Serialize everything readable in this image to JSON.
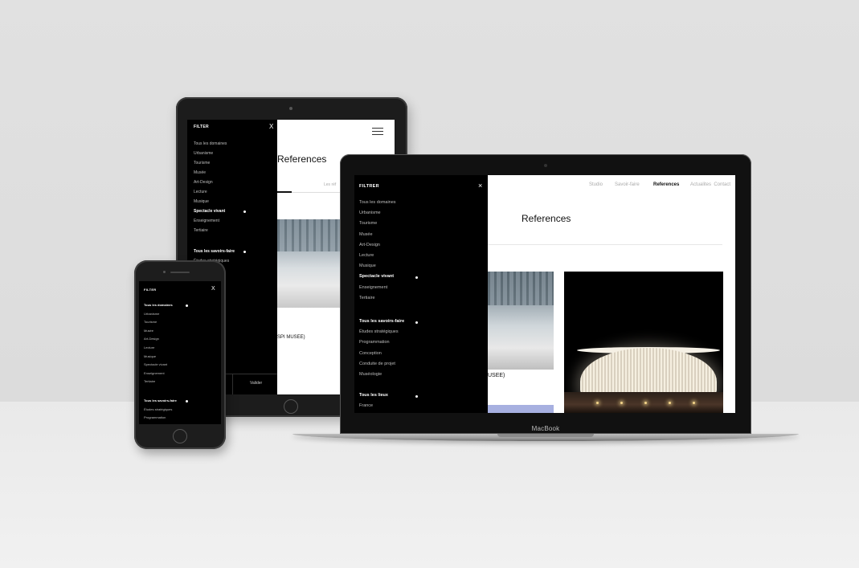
{
  "tablet": {
    "filter": {
      "title": "FILTER",
      "close": "X",
      "domains": [
        {
          "label": "Tous les domaines",
          "active": false
        },
        {
          "label": "Urbanisme",
          "active": false
        },
        {
          "label": "Tourisme",
          "active": false
        },
        {
          "label": "Musée",
          "active": false
        },
        {
          "label": "Art-Design",
          "active": false
        },
        {
          "label": "Lecture",
          "active": false
        },
        {
          "label": "Musique",
          "active": false
        },
        {
          "label": "Spectacle vivant",
          "active": true
        },
        {
          "label": "Enseignement",
          "active": false
        },
        {
          "label": "Tertiaire",
          "active": false
        }
      ],
      "savoir_faire": [
        {
          "label": "Tous les savoirs-faire",
          "active": true
        },
        {
          "label": "Études stratégiques",
          "active": false
        }
      ],
      "valider": "Valider"
    },
    "page_title": "References",
    "tab_label": "Les réf",
    "caption": "SPI MUSEE)"
  },
  "phone": {
    "filter": {
      "title": "FILTER",
      "close": "X",
      "domains": [
        {
          "label": "Tous les domaines",
          "active": true
        },
        {
          "label": "Urbanisme",
          "active": false
        },
        {
          "label": "Tourisme",
          "active": false
        },
        {
          "label": "Musée",
          "active": false
        },
        {
          "label": "Art-Design",
          "active": false
        },
        {
          "label": "Lecture",
          "active": false
        },
        {
          "label": "Musique",
          "active": false
        },
        {
          "label": "Spectacle vivant",
          "active": false
        },
        {
          "label": "Enseignement",
          "active": false
        },
        {
          "label": "Tertiaire",
          "active": false
        }
      ],
      "savoir_faire": [
        {
          "label": "Tous les savoirs-faire",
          "active": true
        },
        {
          "label": "Études stratégiques",
          "active": false
        },
        {
          "label": "Programmation",
          "active": false
        }
      ]
    }
  },
  "laptop": {
    "brand": "MacBook",
    "filter": {
      "title": "FILTRER",
      "close": "×",
      "domains": [
        {
          "label": "Tous les domaines",
          "active": false
        },
        {
          "label": "Urbanisme",
          "active": false
        },
        {
          "label": "Tourisme",
          "active": false
        },
        {
          "label": "Musée",
          "active": false
        },
        {
          "label": "Art-Design",
          "active": false
        },
        {
          "label": "Lecture",
          "active": false
        },
        {
          "label": "Musique",
          "active": false
        },
        {
          "label": "Spectacle vivant",
          "active": true
        },
        {
          "label": "Enseignement",
          "active": false
        },
        {
          "label": "Tertiaire",
          "active": false
        }
      ],
      "savoir_faire": [
        {
          "label": "Tous les savoirs-faire",
          "active": true
        },
        {
          "label": "Études stratégiques",
          "active": false
        },
        {
          "label": "Programmation",
          "active": false
        },
        {
          "label": "Conception",
          "active": false
        },
        {
          "label": "Conduite de projet",
          "active": false
        },
        {
          "label": "Muséologie",
          "active": false
        }
      ],
      "lieux": [
        {
          "label": "Tous les lieux",
          "active": true
        },
        {
          "label": "France",
          "active": false
        }
      ]
    },
    "nav": [
      {
        "label": "Studio",
        "active": false
      },
      {
        "label": "Savoir-faire",
        "active": false
      },
      {
        "label": "References",
        "active": true
      },
      {
        "label": "Actualites",
        "active": false
      },
      {
        "label": "Contact",
        "active": false
      }
    ],
    "page_title": "References",
    "caption": "USEE)"
  },
  "colors": {
    "menu_bg": "#000000",
    "accent_blue": "#a7b0e0",
    "text_dark": "#111111"
  }
}
